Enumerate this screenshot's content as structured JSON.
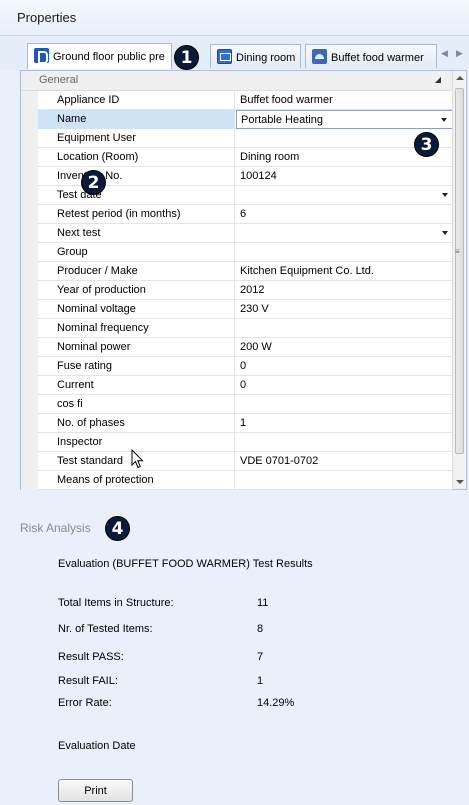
{
  "panel": {
    "title": "Properties"
  },
  "tabs": [
    {
      "label": "Ground floor public pre",
      "icon": "floor-plan-icon"
    },
    {
      "label": "Dining room",
      "icon": "room-icon"
    },
    {
      "label": "Buffet food warmer",
      "icon": "food-warmer-icon"
    }
  ],
  "badges": [
    "1",
    "2",
    "3",
    "4"
  ],
  "properties": {
    "section": "General",
    "rows": [
      {
        "name": "Appliance ID",
        "value": "Buffet food warmer"
      },
      {
        "name": "Name",
        "value": "Portable Heating"
      },
      {
        "name": "Equipment User",
        "value": ""
      },
      {
        "name": "Location (Room)",
        "value": "Dining room"
      },
      {
        "name": "Inventary No.",
        "value": "100124"
      },
      {
        "name": "Test date",
        "value": ""
      },
      {
        "name": "Retest period (in months)",
        "value": "6"
      },
      {
        "name": "Next test",
        "value": ""
      },
      {
        "name": "Group",
        "value": ""
      },
      {
        "name": "Producer / Make",
        "value": "Kitchen Equipment Co. Ltd."
      },
      {
        "name": "Year of production",
        "value": "2012"
      },
      {
        "name": "Nominal voltage",
        "value": "230 V"
      },
      {
        "name": "Nominal frequency",
        "value": ""
      },
      {
        "name": "Nominal power",
        "value": "200 W"
      },
      {
        "name": "Fuse rating",
        "value": "0"
      },
      {
        "name": "Current",
        "value": "0"
      },
      {
        "name": "cos fi",
        "value": ""
      },
      {
        "name": "No. of phases",
        "value": "1"
      },
      {
        "name": "Inspector",
        "value": ""
      },
      {
        "name": "Test standard",
        "value": "VDE 0701-0702"
      },
      {
        "name": "Means of protection",
        "value": ""
      }
    ]
  },
  "risk": {
    "title": "Risk Analysis",
    "evaluation_title": "Evaluation (BUFFET FOOD WARMER) Test Results",
    "stats": [
      {
        "label": "Total Items in Structure:",
        "value": "11"
      },
      {
        "label": "Nr. of Tested Items:",
        "value": "8"
      },
      {
        "label": "Result PASS:",
        "value": "7"
      },
      {
        "label": "Result FAIL:",
        "value": "1"
      },
      {
        "label": "Error Rate:",
        "value": "14.29%"
      }
    ],
    "evaluation_date_label": "Evaluation Date",
    "print_label": "Print"
  },
  "colors": {
    "badge": "#0c1a3a",
    "selection": "#cfe3f7",
    "panel_bg": "#e9f0fa"
  }
}
